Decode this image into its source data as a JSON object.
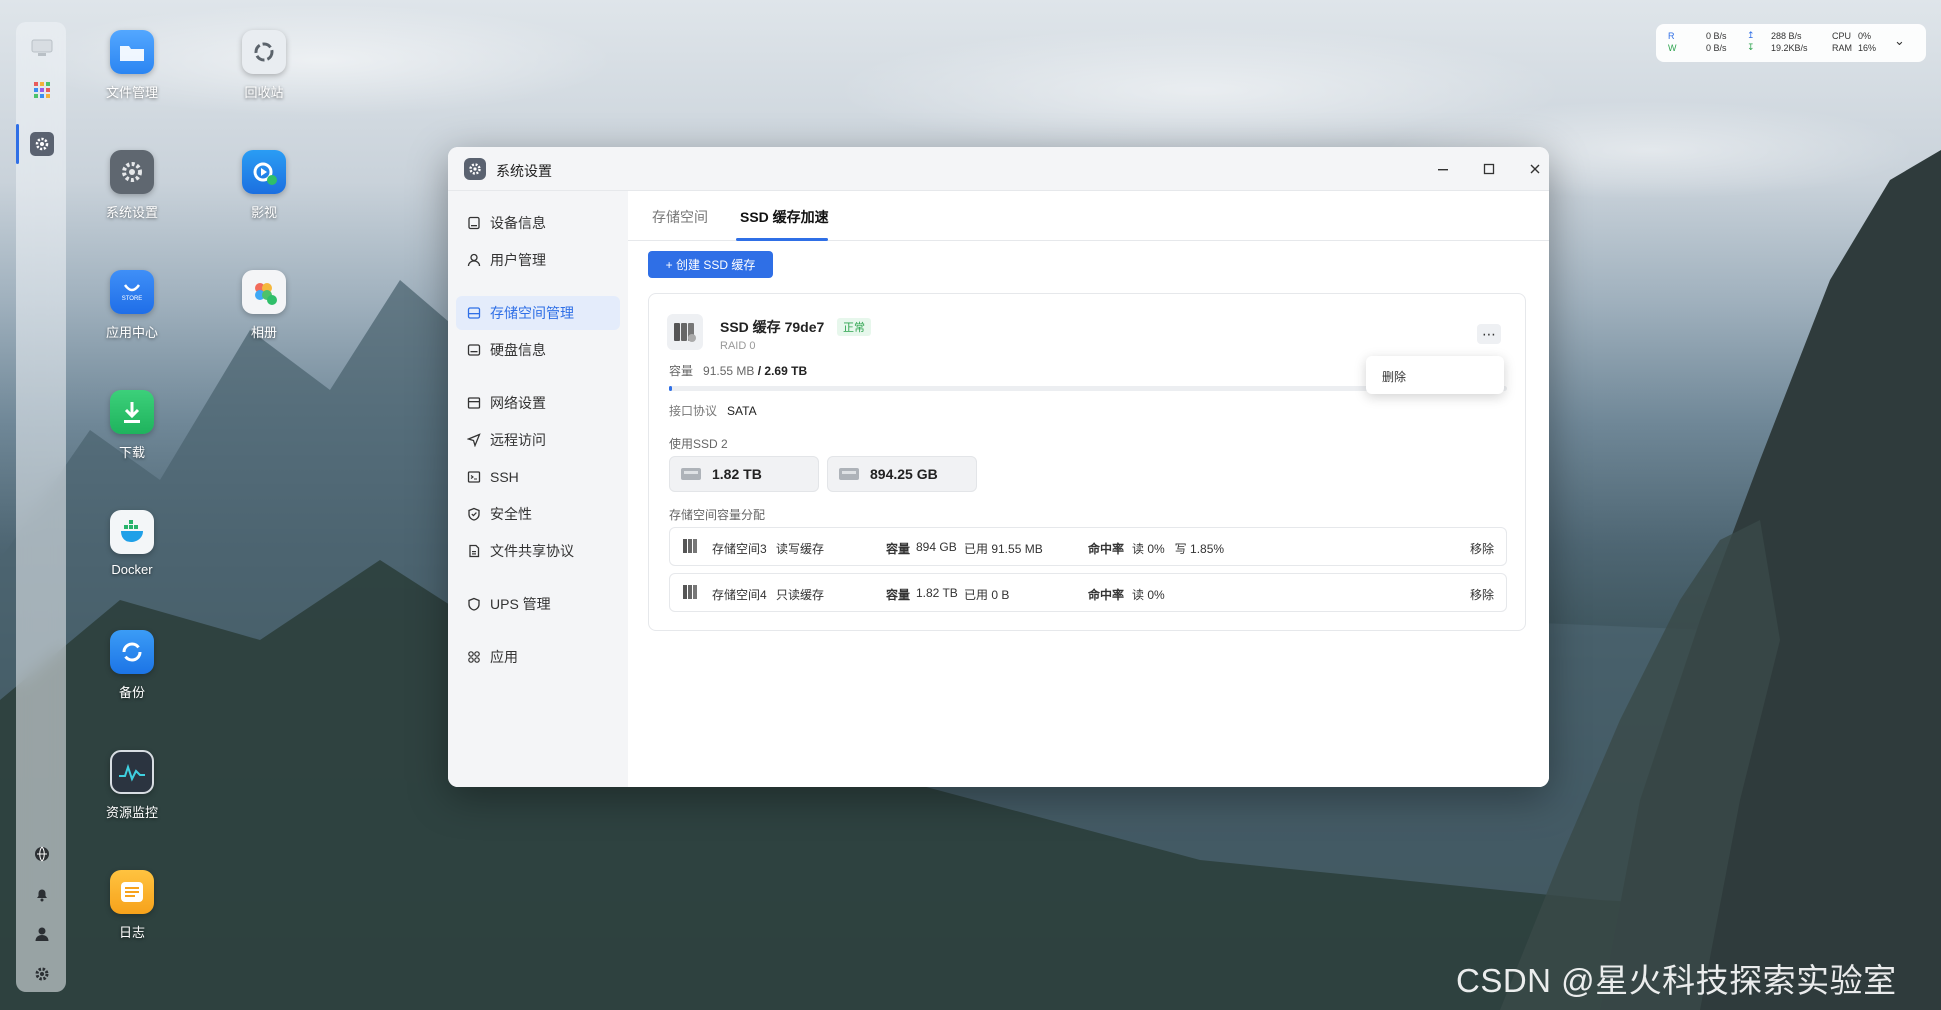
{
  "desktop": {
    "icons": [
      {
        "label": "文件管理"
      },
      {
        "label": "回收站"
      },
      {
        "label": "系统设置"
      },
      {
        "label": "影视"
      },
      {
        "label": "应用中心"
      },
      {
        "label": "相册"
      },
      {
        "label": "下载"
      },
      {
        "label": "Docker"
      },
      {
        "label": "备份"
      },
      {
        "label": "资源监控"
      },
      {
        "label": "日志"
      }
    ],
    "app_center_tile_text": "STORE"
  },
  "status_widget": {
    "r_label": "R",
    "w_label": "W",
    "r_disk": "0  B/s",
    "w_disk": "0  B/s",
    "net_up": "288  B/s",
    "net_down": "19.2KB/s",
    "cpu_label": "CPU",
    "ram_label": "RAM",
    "cpu_value": "0%",
    "ram_value": "16%"
  },
  "window": {
    "title": "系统设置",
    "sidebar": {
      "items": [
        {
          "label": "设备信息"
        },
        {
          "label": "用户管理"
        },
        {
          "label": "存储空间管理"
        },
        {
          "label": "硬盘信息"
        },
        {
          "label": "网络设置"
        },
        {
          "label": "远程访问"
        },
        {
          "label": "SSH"
        },
        {
          "label": "安全性"
        },
        {
          "label": "文件共享协议"
        },
        {
          "label": "UPS 管理"
        },
        {
          "label": "应用"
        }
      ]
    },
    "tabs": [
      {
        "label": "存储空间"
      },
      {
        "label": "SSD 缓存加速"
      }
    ],
    "create_button": "+  创建 SSD 缓存",
    "cache": {
      "name": "SSD 缓存 79de7",
      "status": "正常",
      "raid": "RAID 0",
      "capacity_label": "容量",
      "capacity_used": "91.55 MB",
      "capacity_total": "/ 2.69 TB",
      "capacity_fraction": 3.32e-05,
      "protocol_label": "接口协议",
      "protocol_value": "SATA",
      "ssd_label": "使用SSD 2",
      "ssds": [
        {
          "size": "1.82 TB"
        },
        {
          "size": "894.25 GB"
        }
      ],
      "allocation_label": "存储空间容量分配",
      "rows": [
        {
          "name": "存储空间3",
          "mode": "读写缓存",
          "cap_label": "容量",
          "cap_value": "894 GB",
          "used": "已用 91.55 MB",
          "hit_label": "命中率",
          "hit_value": "读 0%   写 1.85%",
          "action": "移除"
        },
        {
          "name": "存储空间4",
          "mode": "只读缓存",
          "cap_label": "容量",
          "cap_value": "1.82 TB",
          "used": "已用 0 B",
          "hit_label": "命中率",
          "hit_value": "读 0%",
          "action": "移除"
        }
      ]
    },
    "context_menu": {
      "items": [
        {
          "label": "删除"
        }
      ]
    }
  },
  "watermark": "CSDN @星火科技探索实验室",
  "colors": {
    "accent": "#2f6fe6",
    "success": "#2ea44f"
  }
}
